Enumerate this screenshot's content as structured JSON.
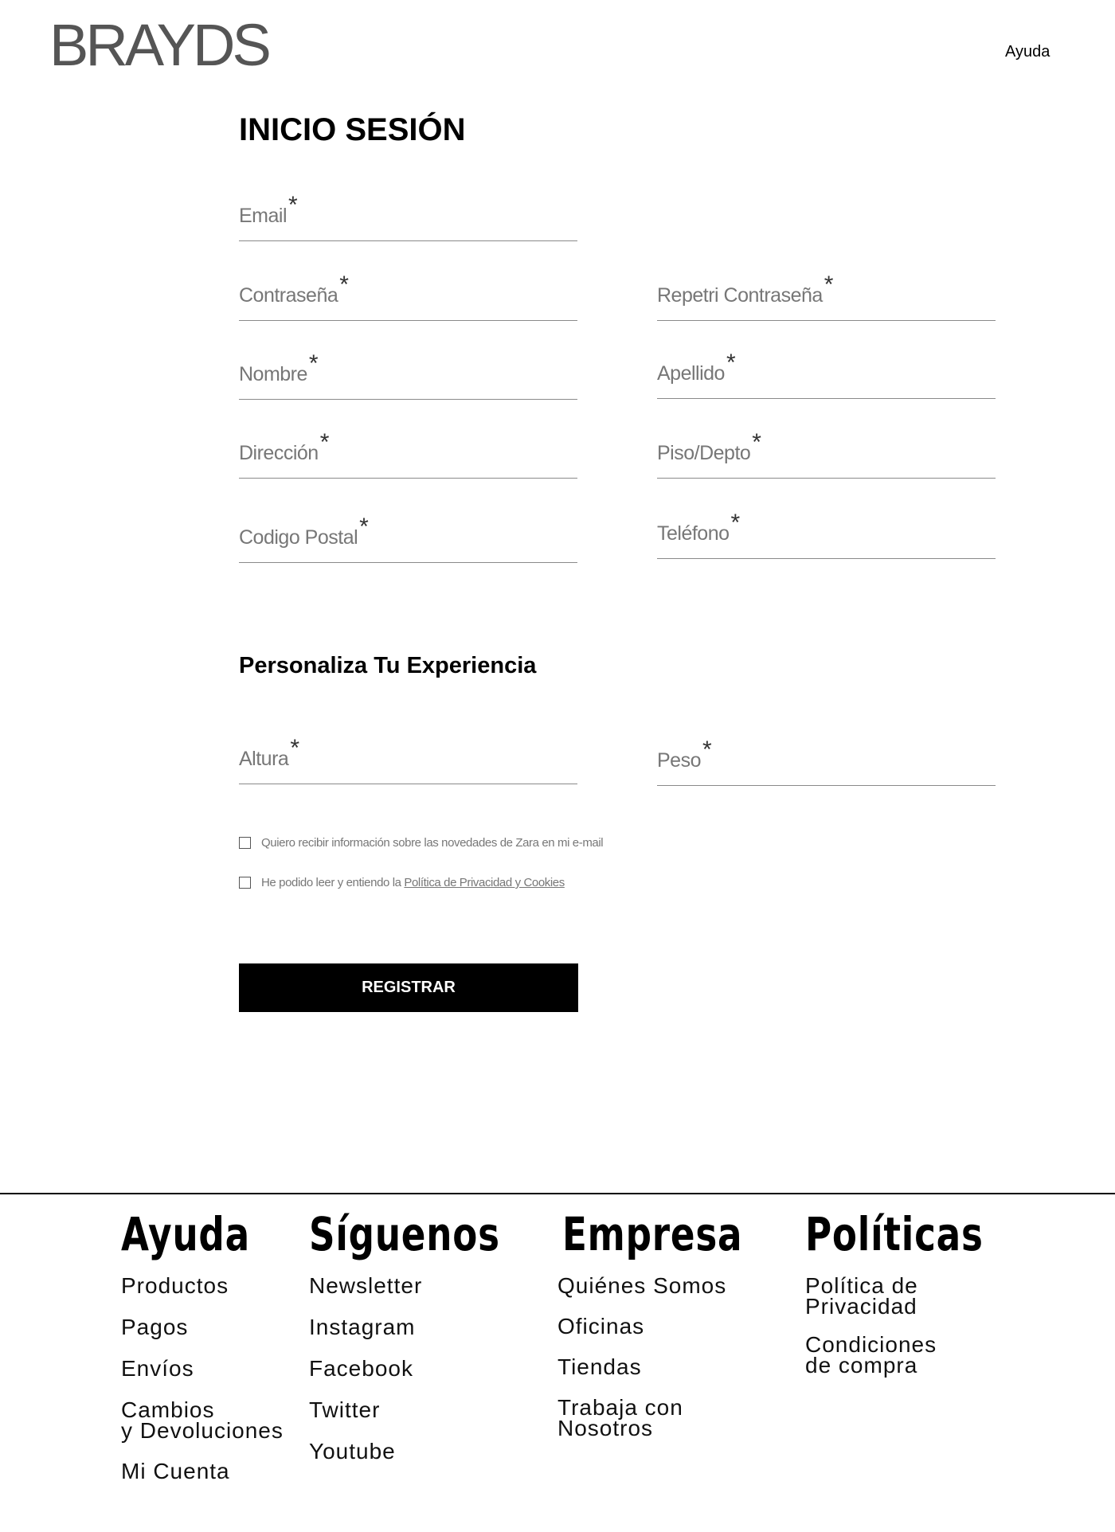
{
  "header": {
    "logo": "BRAYDS",
    "help_label": "Ayuda"
  },
  "form": {
    "title": "INICIO SESIÓN",
    "required_mark": "*",
    "fields": {
      "email": "Email",
      "password": "Contraseña",
      "repeat_password": "Repetri Contraseña",
      "first_name": "Nombre",
      "last_name": "Apellido",
      "address": "Dirección",
      "apartment": "Piso/Depto",
      "postal_code": "Codigo Postal",
      "phone": "Teléfono"
    },
    "personalize_title": "Personaliza Tu Experiencia",
    "personal_fields": {
      "height": "Altura",
      "weight": "Peso"
    },
    "checkboxes": {
      "newsletter": "Quiero recibir información sobre las novedades de Zara en mi e-mail",
      "privacy_prefix": "He podido leer y entiendo la ",
      "privacy_link": "Política de Privacidad y Cookies"
    },
    "submit_label": "REGISTRAR"
  },
  "footer": {
    "columns": [
      {
        "heading": "Ayuda",
        "items": [
          "Productos",
          "Pagos",
          "Envíos",
          "Cambios\ny Devoluciones",
          "Mi Cuenta"
        ]
      },
      {
        "heading": "Síguenos",
        "items": [
          "Newsletter",
          "Instagram",
          "Facebook",
          "Twitter",
          "Youtube"
        ]
      },
      {
        "heading": "Empresa",
        "items": [
          "Quiénes Somos",
          "Oficinas",
          "Tiendas",
          "Trabaja con\nNosotros"
        ]
      },
      {
        "heading": "Políticas",
        "items": [
          "Política de\nPrivacidad",
          "Condiciones\nde compra"
        ]
      }
    ]
  }
}
